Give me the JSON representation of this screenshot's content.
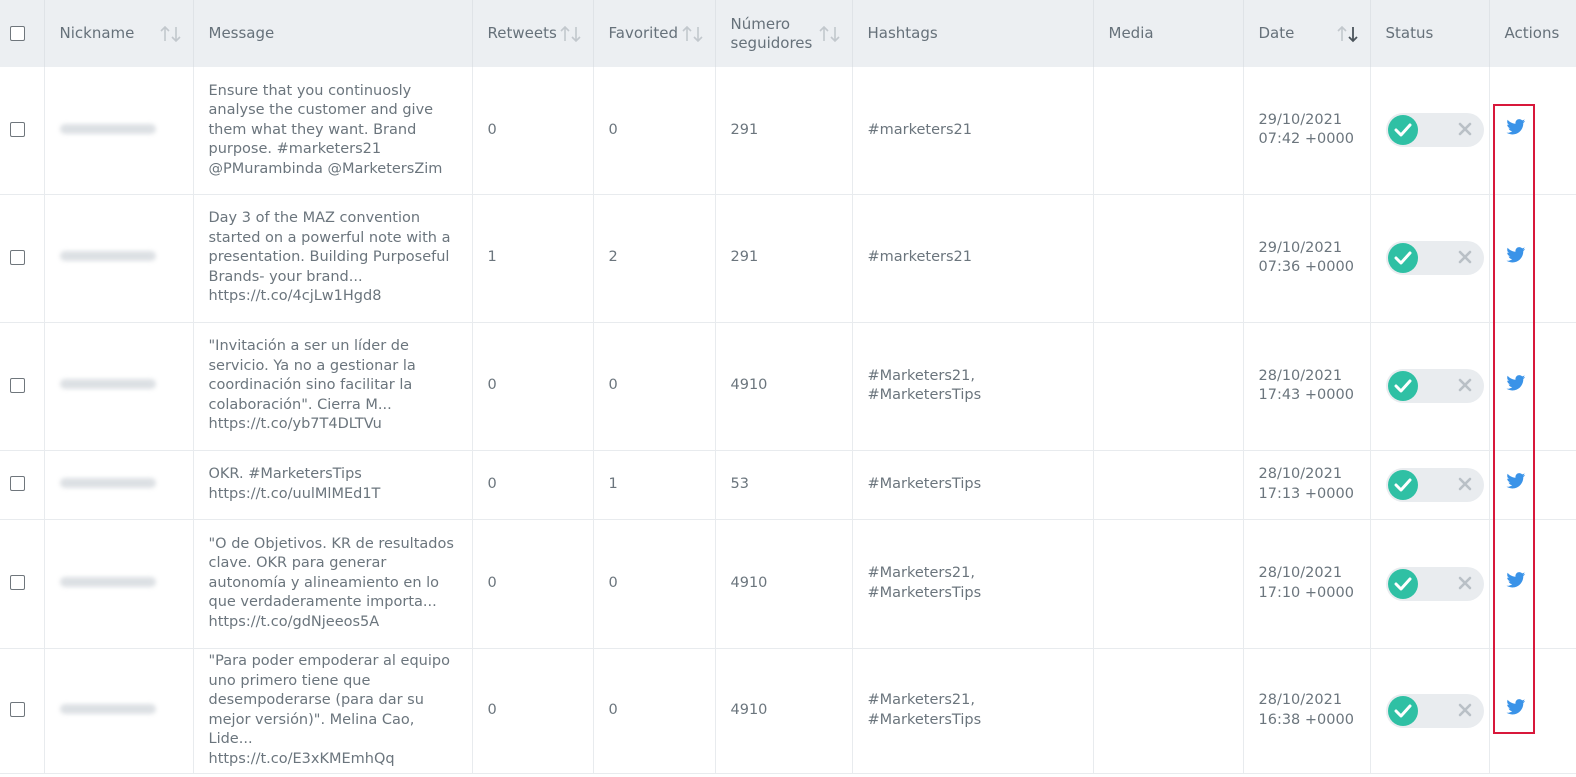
{
  "columns": {
    "nickname": "Nickname",
    "message": "Message",
    "retweets": "Retweets",
    "favorited": "Favorited",
    "seguidores_1": "Número",
    "seguidores_2": "seguidores",
    "hashtags": "Hashtags",
    "media": "Media",
    "date": "Date",
    "status": "Status",
    "actions": "Actions"
  },
  "rows": [
    {
      "msg": [
        "Ensure that you continuosly",
        "analyse the customer and give",
        "them what they want. Brand",
        "purpose. #marketers21",
        "@PMurambinda @MarketersZim"
      ],
      "retweets": "0",
      "favorited": "0",
      "seguidores": "291",
      "hashtags": [
        "#marketers21"
      ],
      "media": "",
      "date": [
        "29/10/2021",
        "07:42 +0000"
      ]
    },
    {
      "msg": [
        "Day 3 of the MAZ convention",
        "started on a powerful note with a",
        "presentation. Building Purposeful",
        "Brands- your brand...",
        "https://t.co/4cjLw1Hgd8"
      ],
      "retweets": "1",
      "favorited": "2",
      "seguidores": "291",
      "hashtags": [
        "#marketers21"
      ],
      "media": "",
      "date": [
        "29/10/2021",
        "07:36 +0000"
      ]
    },
    {
      "msg": [
        "\"Invitación a ser un líder de",
        "servicio. Ya no a gestionar la",
        "coordinación sino facilitar la",
        "colaboración\". Cierra M...",
        "https://t.co/yb7T4DLTVu"
      ],
      "retweets": "0",
      "favorited": "0",
      "seguidores": "4910",
      "hashtags": [
        "#Marketers21,",
        "#MarketersTips"
      ],
      "media": "",
      "date": [
        "28/10/2021",
        "17:43 +0000"
      ]
    },
    {
      "msg": [
        "OKR. #MarketersTips",
        "https://t.co/uulMlMEd1T"
      ],
      "retweets": "0",
      "favorited": "1",
      "seguidores": "53",
      "hashtags": [
        "#MarketersTips"
      ],
      "media": "",
      "date": [
        "28/10/2021",
        "17:13 +0000"
      ]
    },
    {
      "msg": [
        "\"O de Objetivos. KR de resultados",
        "clave. OKR para generar",
        "autonomía y alineamiento en lo",
        "que verdaderamente importa...",
        "https://t.co/gdNjeeos5A"
      ],
      "retweets": "0",
      "favorited": "0",
      "seguidores": "4910",
      "hashtags": [
        "#Marketers21,",
        "#MarketersTips"
      ],
      "media": "",
      "date": [
        "28/10/2021",
        "17:10 +0000"
      ]
    },
    {
      "msg": [
        "\"Para poder empoderar al equipo",
        "uno primero tiene que",
        "desempoderarse (para dar su",
        "mejor versión)\". Melina Cao, Lide...",
        "https://t.co/E3xKMEmhQq"
      ],
      "retweets": "0",
      "favorited": "0",
      "seguidores": "4910",
      "hashtags": [
        "#Marketers21,",
        "#MarketersTips"
      ],
      "media": "",
      "date": [
        "28/10/2021",
        "16:38 +0000"
      ]
    }
  ],
  "status_toggle": {
    "state": "on",
    "on_icon": "check-icon",
    "off_icon": "x-icon"
  },
  "action_icon": "twitter-bird-icon",
  "colors": {
    "header_bg": "#eceff2",
    "toggle_on": "#2fc0a4",
    "twitter_blue": "#3a93e8",
    "highlight": "#d8183b"
  }
}
